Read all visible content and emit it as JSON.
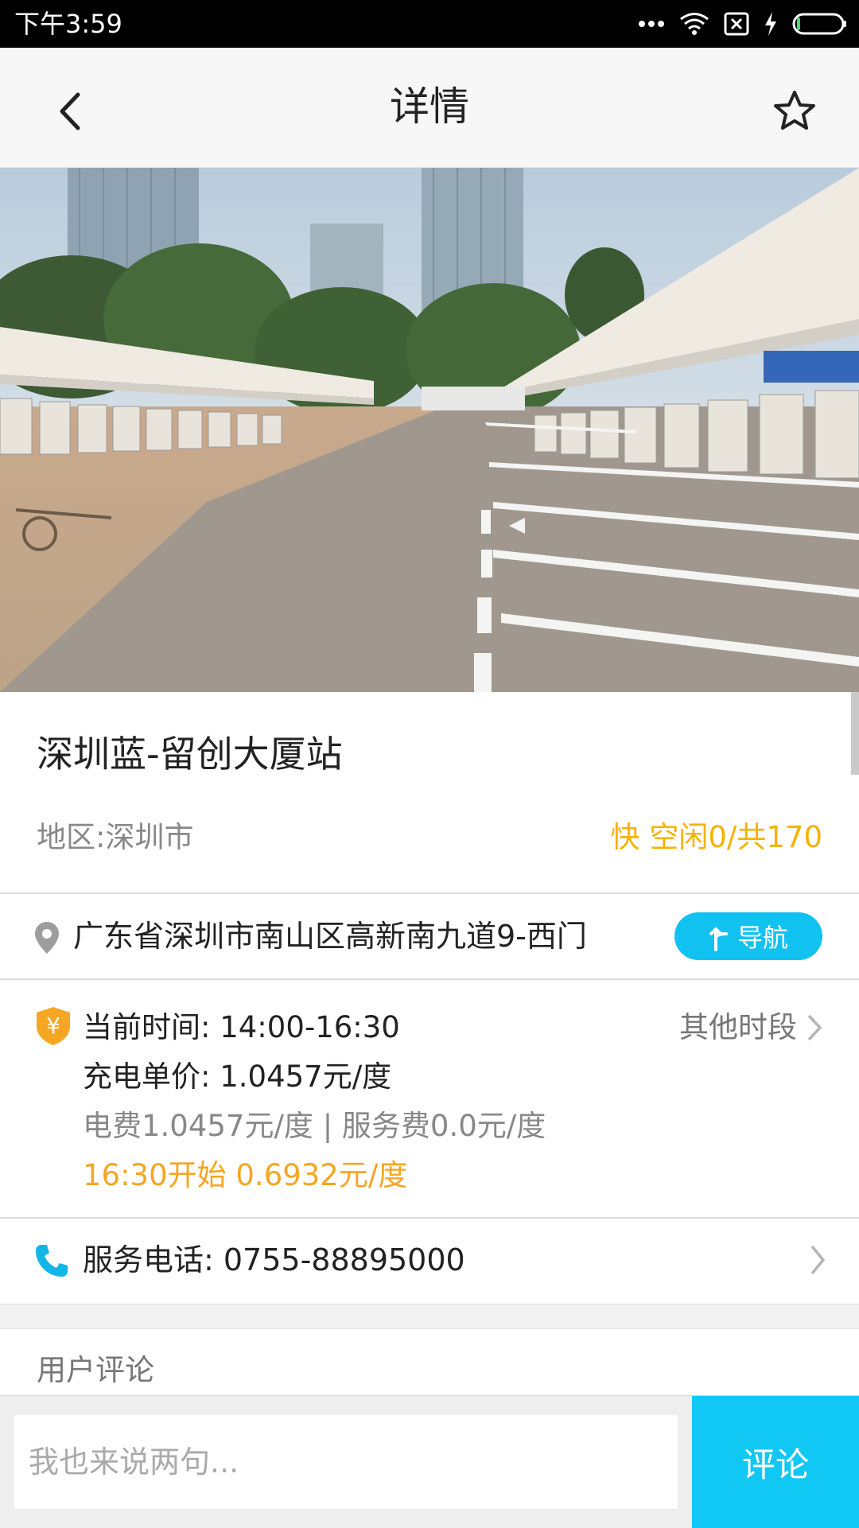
{
  "status_bar": {
    "time": "下午3:59"
  },
  "header": {
    "title": "详情"
  },
  "station": {
    "name": "深圳蓝-留创大厦站",
    "region": "地区:深圳市",
    "availability": "快 空闲0/共170"
  },
  "address": {
    "text": "广东省深圳市南山区高新南九道9-西门",
    "navigate_label": "导航"
  },
  "pricing": {
    "badge_symbol": "¥",
    "current_time": "当前时间: 14:00-16:30",
    "other_periods": "其他时段",
    "unit_price": "充电单价: 1.0457元/度",
    "fee_breakdown": "电费1.0457元/度 | 服务费0.0元/度",
    "next_price": "16:30开始 0.6932元/度"
  },
  "service": {
    "phone": "服务电话: 0755-88895000"
  },
  "comments": {
    "heading": "用户评论",
    "placeholder": "我也来说两句...",
    "submit_label": "评论"
  },
  "colors": {
    "accent": "#11c2f1",
    "availability": "#f5b300",
    "next_price": "#f5a623",
    "badge": "#f5a623"
  }
}
